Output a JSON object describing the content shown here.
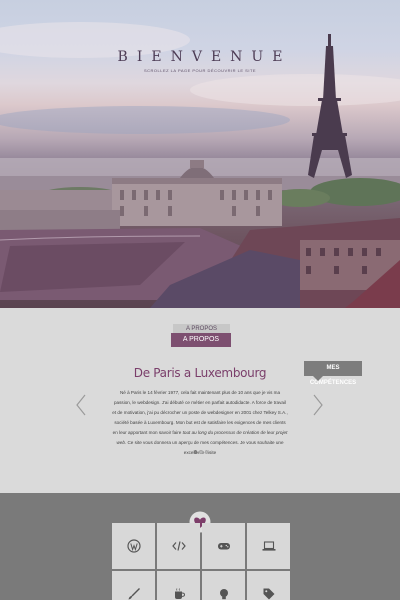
{
  "hero": {
    "title": "BIENVENUE",
    "subtitle": "Scrollez la page pour découvrir le site"
  },
  "about": {
    "tab_back_label": "A PROPOS",
    "tab_front_label": "A PROPOS",
    "side_badge_label": "MES COMPÉTENCES",
    "title": "De Paris a Luxembourg",
    "paragraph_1": "Né à Paris le 14 février 1977, cela fait maintenant plus de 10 ans que je vis ma passion, le webdesign. J'ai débuté ce métier en parfait autodidacte. A force de travail et de motivation, j'ai pu décrocher un poste de webdesigner en 2001 chez Telkey S.A., société basée à Luxembourg. Mon but est de satisfaire les exigences de mes clients en leur apportant mon savoir faire",
    "paragraph_emph": "tout au long du processus de création de leur projet web",
    "paragraph_2": ". Ce site vous donnera un aperçu de mes compétences. Je vous souhaite une excellente visite",
    "slider_dots": 3,
    "active_dot": 0
  },
  "skills": {
    "tiles_row1": [
      "wordpress-icon",
      "code-icon",
      "gamepad-icon",
      "laptop-icon"
    ],
    "tiles_row2": [
      "brush-icon",
      "coffee-icon",
      "lightbulb-icon",
      "tag-icon"
    ]
  },
  "colors": {
    "accent": "#7d4f70",
    "title": "#7a3e6a",
    "panel": "#dadada",
    "skills_bg": "#7a7a7a"
  }
}
